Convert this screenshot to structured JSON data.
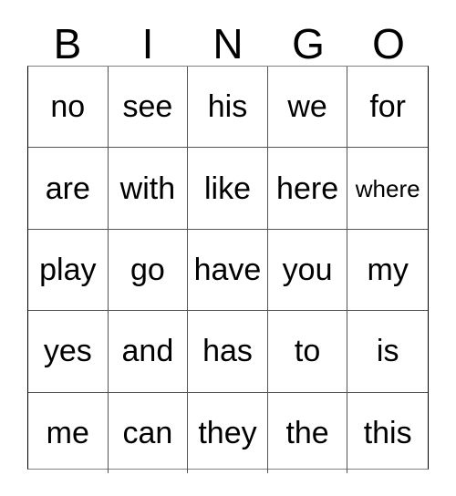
{
  "card": {
    "title": "BINGO",
    "header_letters": [
      "B",
      "I",
      "N",
      "G",
      "O"
    ],
    "grid_colors": {
      "background": "#ffffff",
      "text": "#000000",
      "border": "#555555",
      "outer_border": "#000000"
    },
    "rows": [
      {
        "cells": [
          {
            "word": "no",
            "shrink": false
          },
          {
            "word": "see",
            "shrink": false
          },
          {
            "word": "his",
            "shrink": false
          },
          {
            "word": "we",
            "shrink": false
          },
          {
            "word": "for",
            "shrink": false
          }
        ]
      },
      {
        "cells": [
          {
            "word": "are",
            "shrink": false
          },
          {
            "word": "with",
            "shrink": false
          },
          {
            "word": "like",
            "shrink": false
          },
          {
            "word": "here",
            "shrink": false
          },
          {
            "word": "where",
            "shrink": true
          }
        ]
      },
      {
        "cells": [
          {
            "word": "play",
            "shrink": false
          },
          {
            "word": "go",
            "shrink": false
          },
          {
            "word": "have",
            "shrink": false
          },
          {
            "word": "you",
            "shrink": false
          },
          {
            "word": "my",
            "shrink": false
          }
        ]
      },
      {
        "cells": [
          {
            "word": "yes",
            "shrink": false
          },
          {
            "word": "and",
            "shrink": false
          },
          {
            "word": "has",
            "shrink": false
          },
          {
            "word": "to",
            "shrink": false
          },
          {
            "word": "is",
            "shrink": false
          }
        ]
      },
      {
        "cells": [
          {
            "word": "me",
            "shrink": false
          },
          {
            "word": "can",
            "shrink": false
          },
          {
            "word": "they",
            "shrink": false
          },
          {
            "word": "the",
            "shrink": false
          },
          {
            "word": "this",
            "shrink": false
          }
        ]
      }
    ]
  }
}
